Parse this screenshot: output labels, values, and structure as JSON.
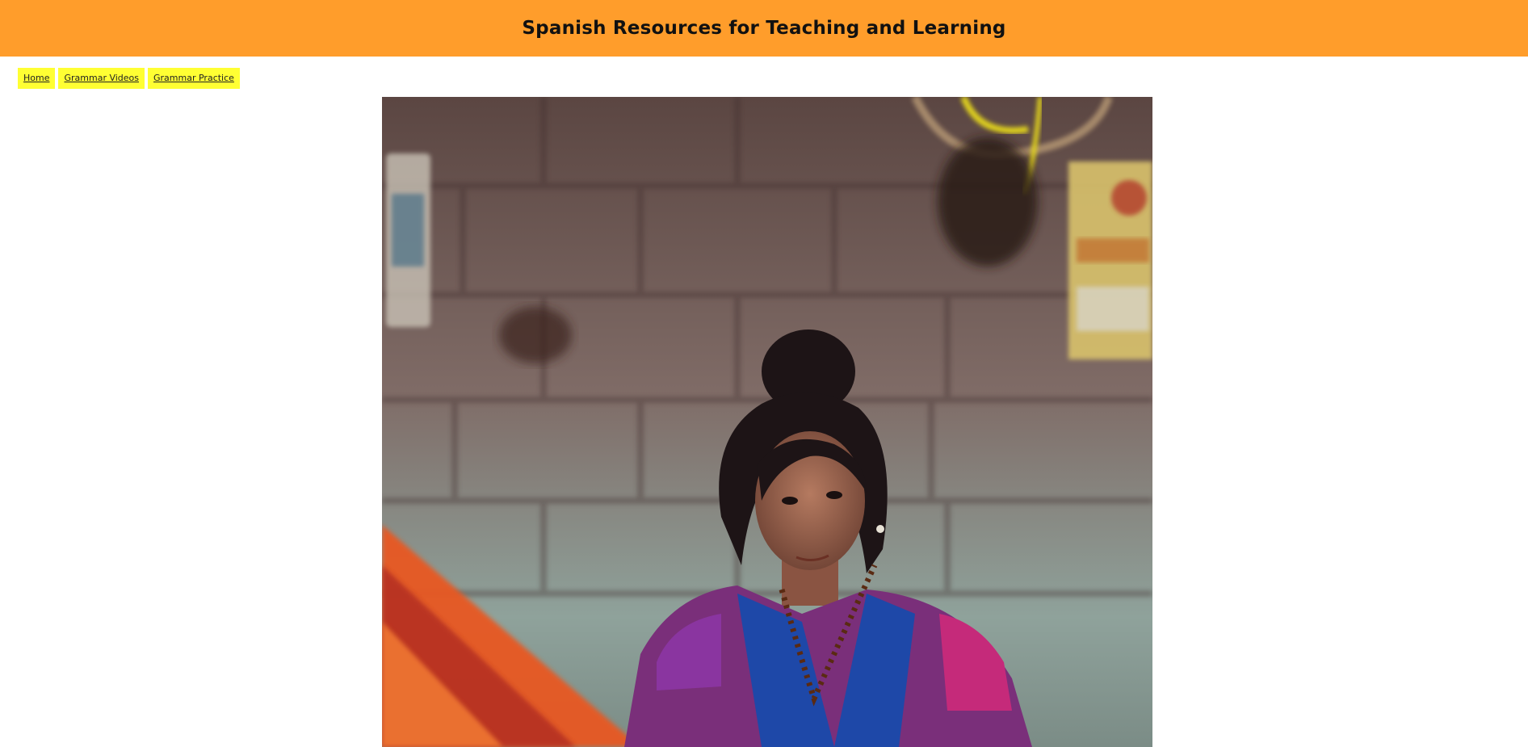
{
  "header": {
    "title": "Spanish Resources for Teaching and Learning"
  },
  "nav": {
    "items": [
      {
        "label": "Home"
      },
      {
        "label": "Grammar Videos"
      },
      {
        "label": "Grammar Practice"
      }
    ]
  },
  "colors": {
    "header_bg": "#ff9d2b",
    "nav_bg": "#ffff33",
    "page_bg": "#ffffff"
  }
}
